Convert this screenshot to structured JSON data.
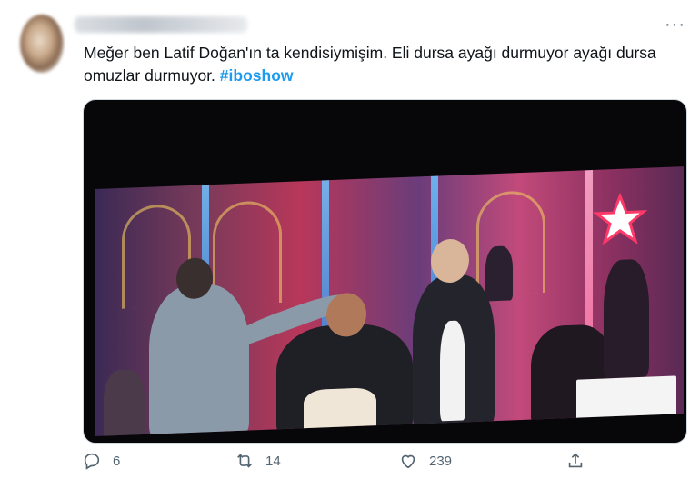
{
  "tweet": {
    "text_main": "Meğer ben Latif Doğan'ın ta kendisiymişim. Eli dursa ayağı durmuyor ayağı dursa omuzlar durmuyor.",
    "hashtag": "#iboshow",
    "more_label": "···"
  },
  "actions": {
    "reply_count": "6",
    "retweet_count": "14",
    "like_count": "239"
  },
  "icons": {
    "reply": "reply-icon",
    "retweet": "retweet-icon",
    "like": "heart-icon",
    "share": "share-icon",
    "more": "more-icon"
  },
  "colors": {
    "accent": "#1d9bf0",
    "text": "#0f1419",
    "muted": "#536471"
  }
}
